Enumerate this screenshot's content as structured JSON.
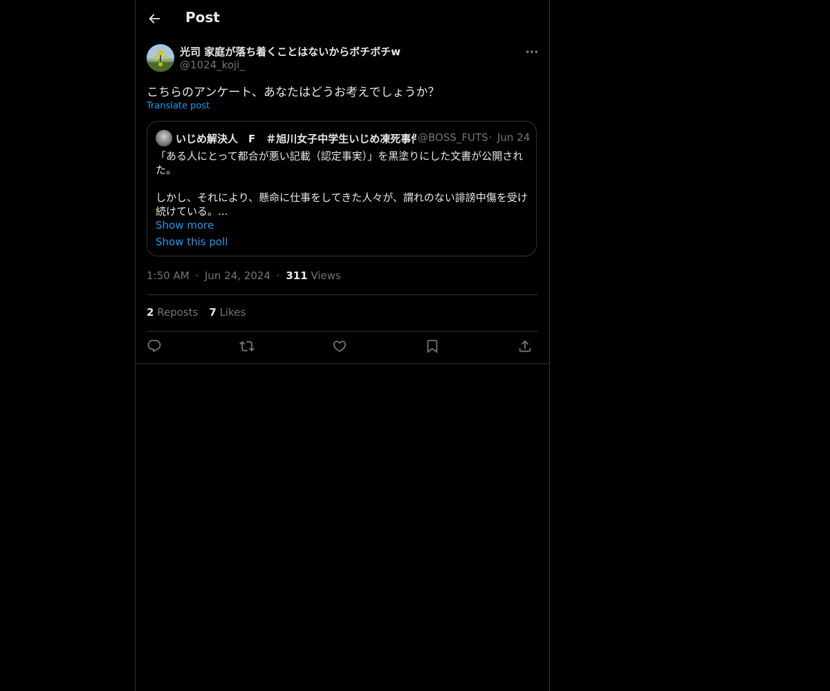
{
  "header": {
    "title": "Post",
    "back_icon": "arrow-left-icon"
  },
  "post": {
    "author_name": "光司 家庭が落ち着くことはないからボチボチw",
    "author_handle": "@1024_koji_",
    "text": "こちらのアンケート、あなたはどうお考えでしょうか？",
    "translate_label": "Translate post",
    "time": "1:50 AM",
    "date": "Jun 24, 2024",
    "views_count": "311",
    "views_label": "Views",
    "reposts_count": "2",
    "reposts_label": "Reposts",
    "likes_count": "7",
    "likes_label": "Likes"
  },
  "quote": {
    "author_name": "いじめ解決人　F　＃旭川女子中学生いじめ凍死事件",
    "author_handle": "@BOSS_FUTS",
    "date": "Jun 24",
    "line1": "「ある人にとって都合が悪い記載（認定事実）」を黒塗りにした文書が公開された。",
    "line2": "しかし、それにより、懸命に仕事をしてきた人々が、謂れのない誹謗中傷を受け続けている。...",
    "show_more": "Show more",
    "show_poll": "Show this poll"
  },
  "separator": "·",
  "colors": {
    "background": "#000000",
    "text": "#e7e9ea",
    "muted": "#71767b",
    "link": "#1d9bf0",
    "border": "#2f3336"
  }
}
